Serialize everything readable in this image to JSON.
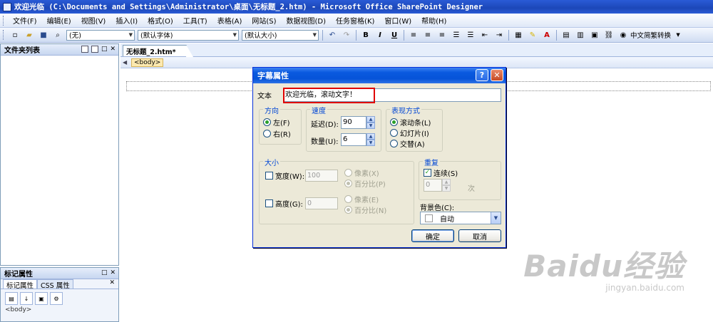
{
  "window": {
    "title": "欢迎光临 (C:\\Documents and Settings\\Administrator\\桌面\\无标题_2.htm) - Microsoft Office SharePoint Designer"
  },
  "menu": [
    "文件(F)",
    "编辑(E)",
    "视图(V)",
    "插入(I)",
    "格式(O)",
    "工具(T)",
    "表格(A)",
    "网站(S)",
    "数据视图(D)",
    "任务窗格(K)",
    "窗口(W)",
    "帮助(H)"
  ],
  "toolbar": {
    "style_value": "(无)",
    "font_value": "(默认字体)",
    "size_value": "(默认大小)",
    "bold": "B",
    "italic": "I",
    "underline": "U",
    "convert_label": "中文简繁转换"
  },
  "folder_pane": {
    "title": "文件夹列表"
  },
  "tag_pane": {
    "title": "标记属性",
    "tabs": [
      "标记属性",
      "CSS 属性"
    ],
    "body_tag": "<body>"
  },
  "editor": {
    "tab_label": "无标题_2.htm*",
    "quick_tag": "<body>"
  },
  "dialog": {
    "title": "字幕属性",
    "text_label": "文本",
    "text_value": "欢迎光临，滚动文字！",
    "direction": {
      "title": "方向",
      "left": "左(F)",
      "right": "右(R)",
      "selected": "left"
    },
    "speed": {
      "title": "速度",
      "delay_label": "延迟(D):",
      "delay_value": "90",
      "amount_label": "数量(U):",
      "amount_value": "6"
    },
    "behavior": {
      "title": "表现方式",
      "scroll": "滚动条(L)",
      "slide": "幻灯片(I)",
      "alternate": "交替(A)",
      "selected": "scroll"
    },
    "size": {
      "title": "大小",
      "width_label": "宽度(W):",
      "width_value": "100",
      "height_label": "高度(G):",
      "height_value": "0",
      "pixels_w": "像素(X)",
      "percent_w": "百分比(P)",
      "pixels_h": "像素(E)",
      "percent_h": "百分比(N)"
    },
    "repeat": {
      "title": "重复",
      "continuous_label": "连续(S)",
      "continuous_checked": true,
      "count_value": "0",
      "times_label": "次"
    },
    "bgcolor": {
      "label": "背景色(C):",
      "value": "自动"
    },
    "ok": "确定",
    "cancel": "取消"
  },
  "watermark": {
    "logo": "Baidu经验",
    "url": "jingyan.baidu.com"
  }
}
